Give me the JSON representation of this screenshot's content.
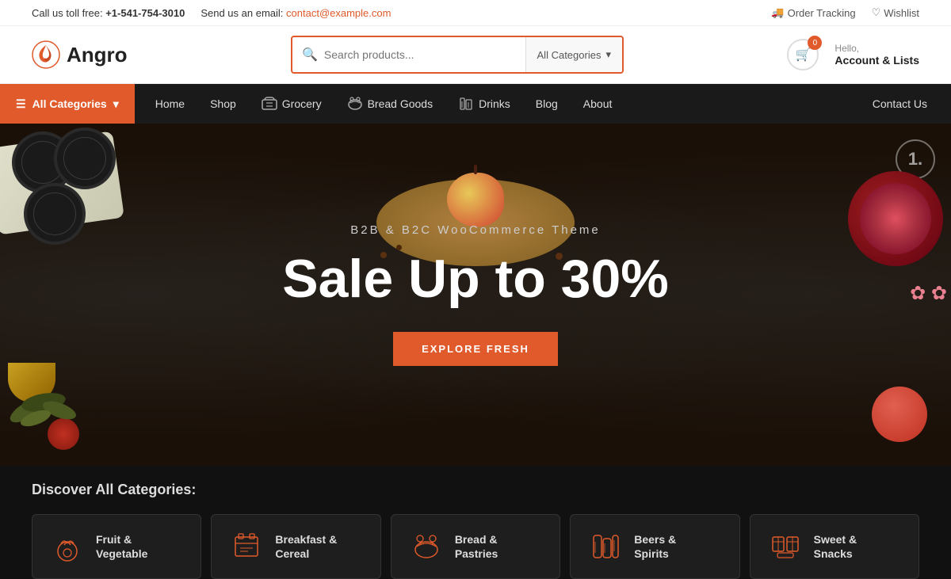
{
  "topbar": {
    "phone_label": "Call us toll free:",
    "phone": "+1-541-754-3010",
    "email_label": "Send us an email:",
    "email": "contact@example.com",
    "order_tracking": "Order Tracking",
    "wishlist": "Wishlist"
  },
  "header": {
    "logo_text": "Angro",
    "search_placeholder": "Search products...",
    "search_category": "All Categories",
    "cart_count": "0",
    "hello": "Hello,",
    "account_label": "Account & Lists"
  },
  "nav": {
    "all_categories": "All Categories",
    "links": [
      {
        "label": "Home",
        "icon": null
      },
      {
        "label": "Shop",
        "icon": null
      },
      {
        "label": "Grocery",
        "icon": "grocery"
      },
      {
        "label": "Bread Goods",
        "icon": "bread"
      },
      {
        "label": "Drinks",
        "icon": "drinks"
      },
      {
        "label": "Blog",
        "icon": null
      },
      {
        "label": "About",
        "icon": null
      }
    ],
    "contact_us": "Contact Us"
  },
  "hero": {
    "subtitle": "B2B & B2C WooCommerce Theme",
    "title": "Sale Up to 30%",
    "button_label": "EXPLORE FRESH"
  },
  "categories": {
    "title": "Discover All Categories:",
    "items": [
      {
        "label": "Fruit & Vegetable",
        "icon": "fruit"
      },
      {
        "label": "Breakfast & Cereal",
        "icon": "breakfast"
      },
      {
        "label": "Bread & Pastries",
        "icon": "bread"
      },
      {
        "label": "Beers & Spirits",
        "icon": "beers"
      },
      {
        "label": "Sweet & Snacks",
        "icon": "snacks"
      }
    ]
  }
}
